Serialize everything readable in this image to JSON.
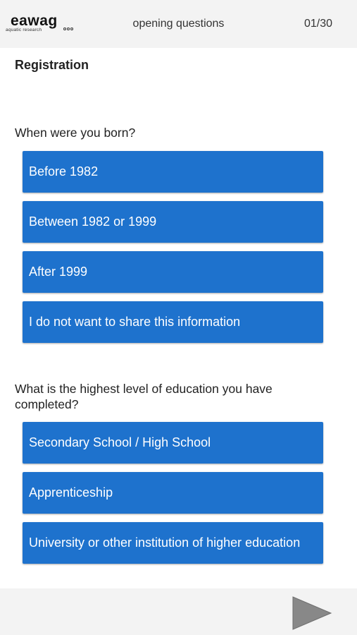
{
  "header": {
    "logo_text": "eawag",
    "logo_subtitle": "aquatic research",
    "title": "opening questions",
    "counter": "01/30"
  },
  "section": {
    "title": "Registration"
  },
  "questions": [
    {
      "text": "When were you born?",
      "options": [
        "Before 1982",
        "Between 1982 or 1999",
        "After 1999",
        "I do not want to share this information"
      ]
    },
    {
      "text": "What is the highest level of education you have completed?",
      "options": [
        "Secondary School / High School",
        "Apprenticeship",
        "University or other institution of higher education"
      ]
    }
  ],
  "footer": {
    "next_icon": "play-arrow-icon"
  },
  "colors": {
    "option_background": "#1e72cd",
    "header_background": "#f3f3f3",
    "arrow": "#888888"
  }
}
